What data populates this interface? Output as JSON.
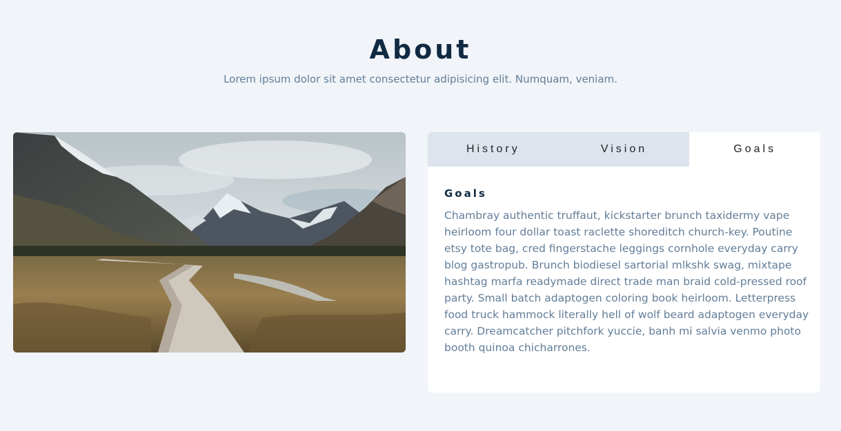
{
  "section": {
    "title": "About",
    "subtitle": "Lorem ipsum dolor sit amet consectetur adipisicing elit. Numquam, veniam."
  },
  "image": {
    "description_icon": "mountain-landscape-photo"
  },
  "tabs": [
    {
      "label": "History",
      "active": false
    },
    {
      "label": "Vision",
      "active": false
    },
    {
      "label": "Goals",
      "active": true
    }
  ],
  "content": {
    "heading": "Goals",
    "body": "Chambray authentic truffaut, kickstarter brunch taxidermy vape heirloom four dollar toast raclette shoreditch church-key. Poutine etsy tote bag, cred fingerstache leggings cornhole everyday carry blog gastropub. Brunch biodiesel sartorial mlkshk swag, mixtape hashtag marfa readymade direct trade man braid cold-pressed roof party. Small batch adaptogen coloring book heirloom. Letterpress food truck hammock literally hell of wolf beard adaptogen everyday carry. Dreamcatcher pitchfork yuccie, banh mi salvia venmo photo booth quinoa chicharrones."
  },
  "colors": {
    "background": "#f1f4f8",
    "title": "#102a42",
    "text": "#617d98",
    "tab_inactive": "#dde4ed",
    "tab_active": "#ffffff"
  }
}
